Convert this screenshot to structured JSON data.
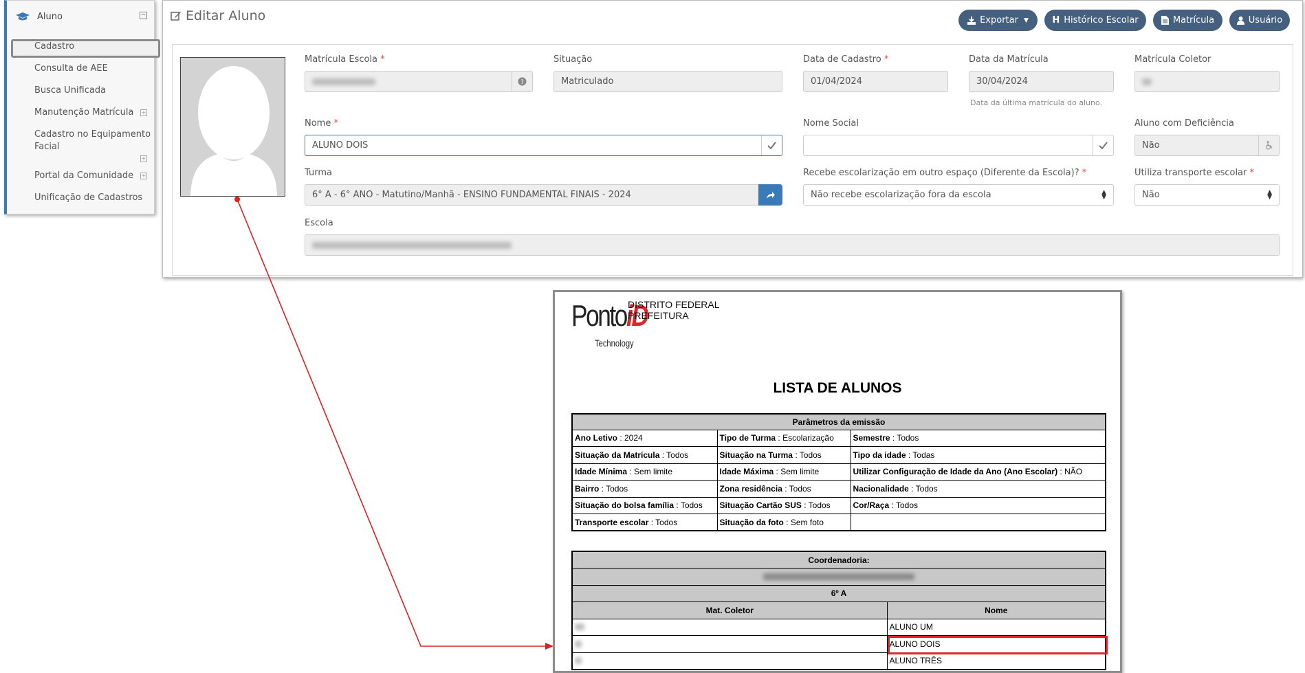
{
  "sidebar": {
    "header": "Aluno",
    "items": [
      {
        "label": "Cadastro"
      },
      {
        "label": "Consulta de AEE"
      },
      {
        "label": "Busca Unificada"
      },
      {
        "label": "Manutenção Matrícula"
      },
      {
        "label": "Cadastro no Equipamento"
      },
      {
        "label": "Facial"
      },
      {
        "label": "Portal da Comunidade"
      },
      {
        "label": "Unificação de Cadastros"
      }
    ]
  },
  "header": {
    "title": "Editar Aluno",
    "buttons": {
      "exportar": "Exportar",
      "historico": "Histórico Escolar",
      "matricula": "Matrícula",
      "usuario": "Usuário"
    }
  },
  "form": {
    "matricula_escola_label": "Matrícula Escola",
    "situacao_label": "Situação",
    "situacao_value": "Matriculado",
    "data_cadastro_label": "Data de Cadastro",
    "data_cadastro_value": "01/04/2024",
    "data_matricula_label": "Data da Matrícula",
    "data_matricula_value": "30/04/2024",
    "data_matricula_hint": "Data da última matrícula do aluno.",
    "matricula_coletor_label": "Matrícula Coletor",
    "nome_label": "Nome",
    "nome_value": "ALUNO DOIS",
    "nome_social_label": "Nome Social",
    "nome_social_value": "",
    "deficiencia_label": "Aluno com Deficiência",
    "deficiencia_value": "Não",
    "turma_label": "Turma",
    "turma_value": "6° A - 6° ANO - Matutino/Manhã - ENSINO FUNDAMENTAL FINAIS - 2024",
    "escolarizacao_label": "Recebe escolarização em outro espaço (Diferente da Escola)?",
    "escolarizacao_value": "Não recebe escolarização fora da escola",
    "transporte_label": "Utiliza transporte escolar",
    "transporte_value": "Não",
    "escola_label": "Escola",
    "required_mark": "*"
  },
  "report": {
    "brand": "Ponto",
    "brand_id": "iD",
    "brand_sub": "Technology",
    "org_line1": "DISTRITO FEDERAL",
    "org_line2": "PREFEITURA",
    "title": "LISTA DE ALUNOS",
    "params_header": "Parâmetros da emissão",
    "params": [
      [
        {
          "k": "Ano Letivo",
          "v": " : 2024"
        },
        {
          "k": "Tipo de Turma",
          "v": " : Escolarização"
        },
        {
          "k": "Semestre",
          "v": " : Todos"
        }
      ],
      [
        {
          "k": "Situação da Matrícula",
          "v": " : Todos"
        },
        {
          "k": "Situação na Turma",
          "v": " : Todos"
        },
        {
          "k": "Tipo da idade",
          "v": " : Todas"
        }
      ],
      [
        {
          "k": "Idade Mínima",
          "v": " : Sem limite"
        },
        {
          "k": "Idade Máxima",
          "v": " : Sem limite"
        },
        {
          "k": "Utilizar Configuração de Idade da Ano (Ano Escolar)",
          "v": " : NÃO"
        }
      ],
      [
        {
          "k": "Bairro",
          "v": " : Todos"
        },
        {
          "k": "Zona residência",
          "v": " : Todos"
        },
        {
          "k": "Nacionalidade",
          "v": " : Todos"
        }
      ],
      [
        {
          "k": "Situação do bolsa família",
          "v": " : Todos"
        },
        {
          "k": "Situação Cartão SUS",
          "v": " : Todos"
        },
        {
          "k": "Cor/Raça",
          "v": " : Todos"
        }
      ],
      [
        {
          "k": "Transporte escolar",
          "v": " : Todos"
        },
        {
          "k": "Situação da foto",
          "v": " : Sem foto"
        },
        {
          "k": "",
          "v": ""
        }
      ]
    ],
    "coord_header": "Coordenadoria:",
    "turma": "6º A",
    "col_mat": "Mat. Coletor",
    "col_nome": "Nome",
    "students": [
      "ALUNO UM",
      "ALUNO DOIS",
      "ALUNO TRÊS"
    ]
  },
  "colors": {
    "accent": "#3a7ab9",
    "button": "#44607e",
    "highlight": "#d9262a",
    "arrow": "#e02020"
  }
}
